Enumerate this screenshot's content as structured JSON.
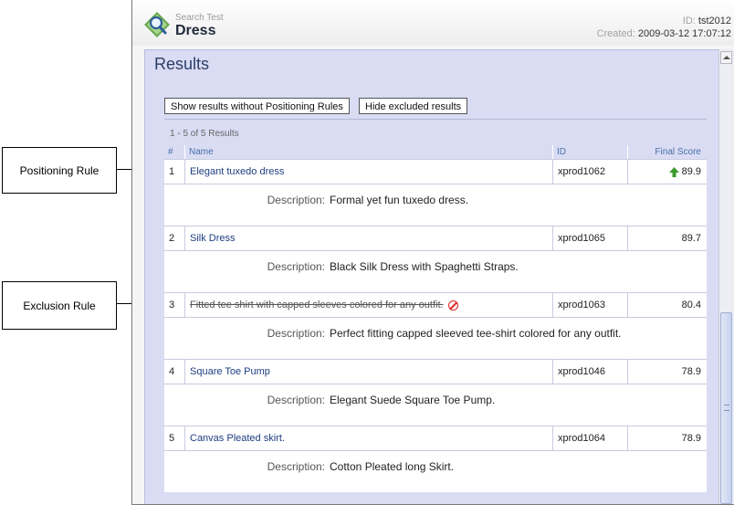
{
  "callouts": {
    "positioning": "Positioning Rule",
    "exclusion": "Exclusion Rule"
  },
  "header": {
    "subtitle": "Search Test",
    "title": "Dress",
    "id_label": "ID:",
    "id_value": "tst2012",
    "created_label": "Created:",
    "created_value": "2009-03-12 17:07:12",
    "logo_icon": "magnifier-search-icon"
  },
  "panel": {
    "heading": "Results",
    "show_without_rules_button": "Show results without Positioning Rules",
    "hide_excluded_button": "Hide excluded results",
    "count": "1 - 5 of 5 Results"
  },
  "table": {
    "columns": [
      "#",
      "Name",
      "ID",
      "Final Score"
    ],
    "description_label": "Description:",
    "rows": [
      {
        "num": "1",
        "name": "Elegant tuxedo dress",
        "id": "xprod1062",
        "score": "89.9",
        "description": "Formal yet fun tuxedo dress.",
        "badge": "up-arrow-icon",
        "excluded": false
      },
      {
        "num": "2",
        "name": "Silk Dress",
        "id": "xprod1065",
        "score": "89.7",
        "description": "Black Silk Dress with Spaghetti Straps.",
        "excluded": false
      },
      {
        "num": "3",
        "name": "Fitted tee shirt with capped sleeves colored for any outfit.",
        "id": "xprod1063",
        "score": "80.4",
        "description": "Perfect fitting capped sleeved tee-shirt colored for any outfit.",
        "badge": "excluded-icon",
        "excluded": true
      },
      {
        "num": "4",
        "name": "Square Toe Pump",
        "id": "xprod1046",
        "score": "78.9",
        "description": "Elegant Suede Square Toe Pump.",
        "excluded": false
      },
      {
        "num": "5",
        "name": "Canvas Pleated skirt.",
        "id": "xprod1064",
        "score": "78.9",
        "description": "Cotton Pleated long Skirt.",
        "excluded": false
      }
    ]
  },
  "colors": {
    "panel_bg": "#d9dcf3",
    "link": "#1f3d80",
    "header_text": "#4a6fa8",
    "up_arrow": "#3a9a2a",
    "excluded": "#d22222"
  }
}
